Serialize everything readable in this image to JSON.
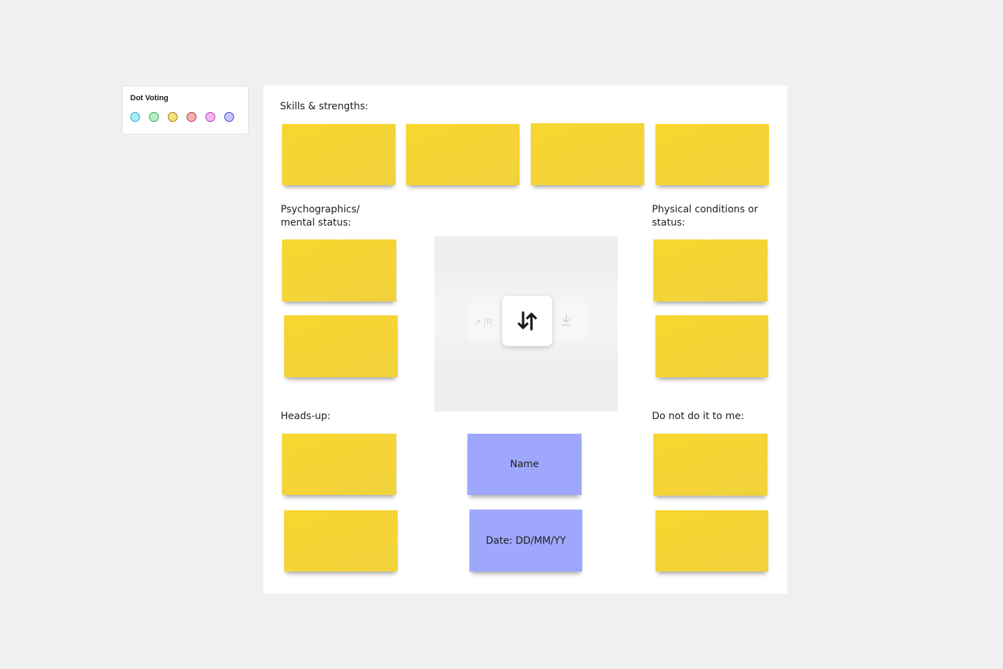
{
  "dot_voting": {
    "title": "Dot Voting",
    "dots": [
      {
        "name": "dot-cyan",
        "fill": "#a8ecf3",
        "stroke": "#2aa9bd"
      },
      {
        "name": "dot-green",
        "fill": "#b5f0c4",
        "stroke": "#2ea55a"
      },
      {
        "name": "dot-yellow",
        "fill": "#f7e37e",
        "stroke": "#8e7a14"
      },
      {
        "name": "dot-red",
        "fill": "#f7b0b0",
        "stroke": "#b33434"
      },
      {
        "name": "dot-pink",
        "fill": "#f7b4f5",
        "stroke": "#b134ad"
      },
      {
        "name": "dot-violet",
        "fill": "#c3c6fd",
        "stroke": "#4046b4"
      }
    ]
  },
  "board": {
    "sections": {
      "skills": "Skills & strengths:",
      "psychographics": "Psychographics/\nmental status:",
      "physical": "Physical conditions or\nstatus:",
      "heads_up": "Heads-up:",
      "do_not": "Do not do it to me:"
    },
    "notes": {
      "name": "Name",
      "date": "Date: DD/MM/YY"
    },
    "media": {
      "faded_label": "↗ [R",
      "swap_icon": "swap-vertical-icon",
      "download_icon": "download-icon"
    }
  },
  "colors": {
    "sticky_yellow": "#f5d432",
    "sticky_violet": "#9ea7fb",
    "canvas": "#f0f0f0"
  }
}
